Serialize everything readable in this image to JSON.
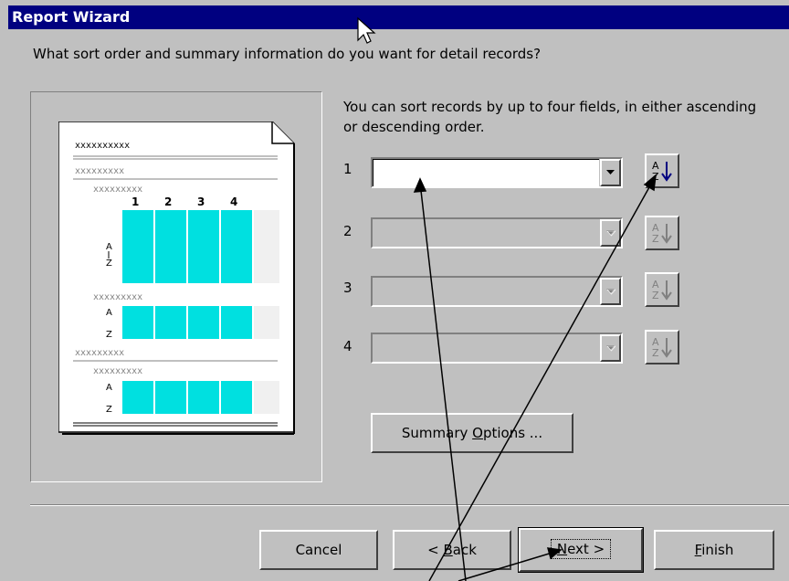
{
  "window": {
    "title": "Report Wizard"
  },
  "question": "What sort order and summary information do you want for detail records?",
  "instructions": "You can sort records by up to four fields, in either ascending or descending order.",
  "sort_rows": [
    {
      "number": "1",
      "value": "",
      "enabled": true
    },
    {
      "number": "2",
      "value": "",
      "enabled": false
    },
    {
      "number": "3",
      "value": "",
      "enabled": false
    },
    {
      "number": "4",
      "value": "",
      "enabled": false
    }
  ],
  "preview": {
    "placeholder_long": "xxxxxxxxxx",
    "placeholder_mid": "xxxxxxxxx",
    "column_numbers": [
      "1",
      "2",
      "3",
      "4"
    ],
    "cell": "xxxx",
    "sort_letters": [
      "A",
      "Z"
    ]
  },
  "buttons": {
    "summary_pre": "Summary ",
    "summary_key": "O",
    "summary_post": "ptions ...",
    "cancel": "Cancel",
    "back_pre": "< ",
    "back_key": "B",
    "back_post": "ack",
    "next_key": "N",
    "next_post": "ext >",
    "finish_key": "F",
    "finish_post": "inish"
  },
  "colors": {
    "title_bar": "#000080",
    "dialog": "#c0c0c0",
    "preview_highlight": "#00e0e0"
  },
  "icons": [
    "sort-ascending-icon",
    "dropdown-arrow-icon",
    "mouse-pointer-icon"
  ]
}
